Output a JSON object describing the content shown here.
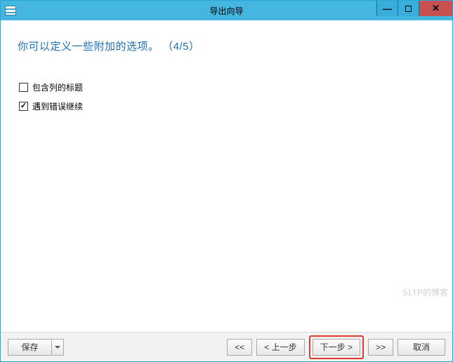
{
  "window": {
    "title": "导出向导"
  },
  "heading": "你可以定义一些附加的选项。 （4/5）",
  "options": {
    "include_headers": {
      "label": "包含列的标题",
      "checked": false
    },
    "continue_on_error": {
      "label": "遇到错误继续",
      "checked": true
    }
  },
  "footer": {
    "save": "保存",
    "first": "<<",
    "prev": "< 上一步",
    "next": "下一步 >",
    "last": ">>",
    "cancel": "取消"
  },
  "watermark": "51TP的博客"
}
